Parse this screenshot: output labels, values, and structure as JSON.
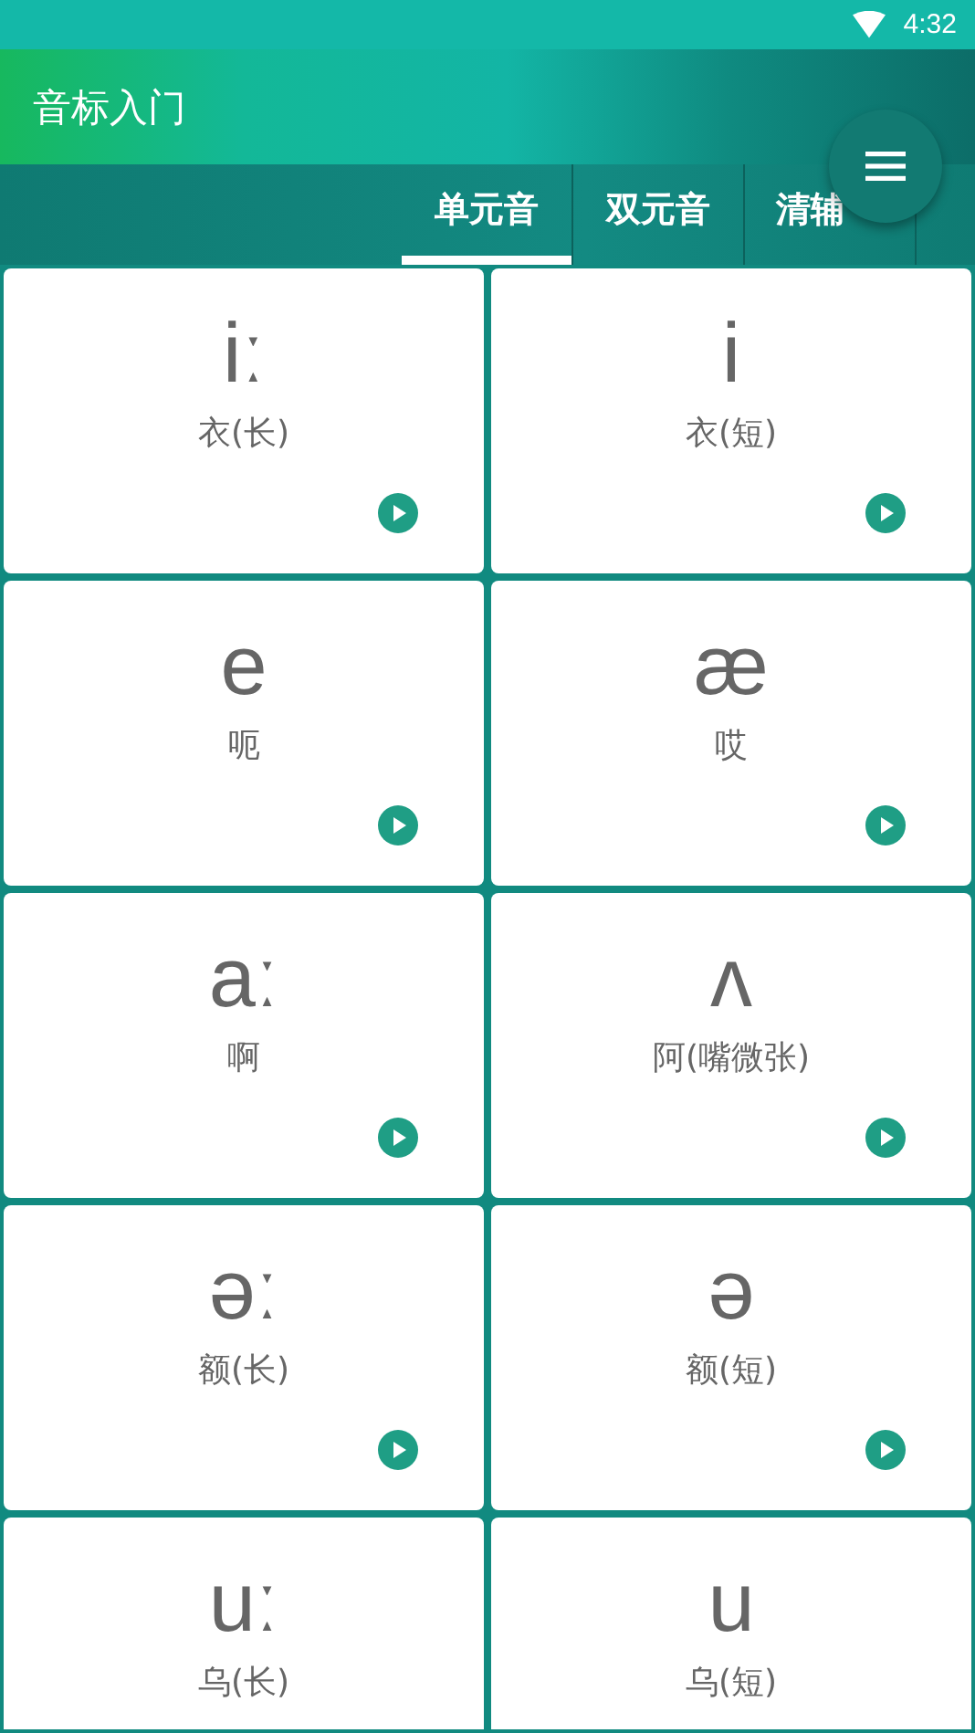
{
  "status_bar": {
    "time": "4:32"
  },
  "app_bar": {
    "title": "音标入门"
  },
  "tabs": [
    {
      "label": "单元音",
      "selected": true
    },
    {
      "label": "双元音",
      "selected": false
    },
    {
      "label": "清辅",
      "selected": false
    }
  ],
  "cards": [
    {
      "symbol": "iː",
      "label": "衣(长)",
      "kind": "full"
    },
    {
      "symbol": "i",
      "label": "衣(短)",
      "kind": "full"
    },
    {
      "symbol": "e",
      "label": "呃",
      "kind": "full"
    },
    {
      "symbol": "æ",
      "label": "哎",
      "kind": "full"
    },
    {
      "symbol": "aː",
      "label": "啊",
      "kind": "full"
    },
    {
      "symbol": "ʌ",
      "label": "阿(嘴微张)",
      "kind": "full"
    },
    {
      "symbol": "əː",
      "label": "额(长)",
      "kind": "full"
    },
    {
      "symbol": "ə",
      "label": "额(短)",
      "kind": "full"
    },
    {
      "symbol": "uː",
      "label": "乌(长)",
      "kind": "cut"
    },
    {
      "symbol": "u",
      "label": "乌(短)",
      "kind": "cut"
    }
  ]
}
